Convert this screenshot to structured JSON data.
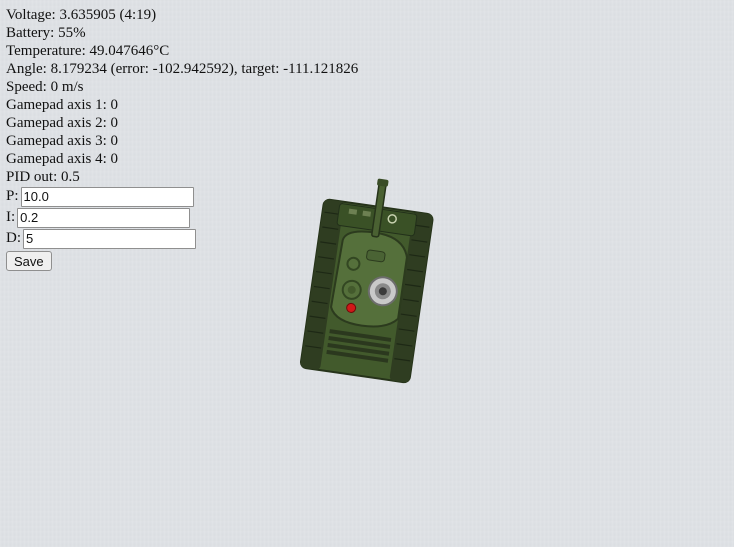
{
  "telemetry": {
    "voltage": "Voltage: 3.635905 (4:19)",
    "battery": "Battery: 55%",
    "temperature": "Temperature: 49.047646°C",
    "angle": "Angle: 8.179234 (error: -102.942592), target: -111.121826",
    "speed": "Speed: 0 m/s",
    "axis1": "Gamepad axis 1: 0",
    "axis2": "Gamepad axis 2: 0",
    "axis3": "Gamepad axis 3: 0",
    "axis4": "Gamepad axis 4: 0",
    "pid_out": "PID out: 0.5"
  },
  "pid_form": {
    "p_label": "P:",
    "p_value": "10.0",
    "i_label": "I:",
    "i_value": "0.2",
    "d_label": "D:",
    "d_value": "5",
    "save_label": "Save"
  },
  "tank": {
    "icon": "tank-image",
    "angle_deg": 8.18,
    "colors": {
      "hull": "#4a6132",
      "turret": "#5b7540",
      "tracks": "#2e3a22",
      "light": "#d01818"
    }
  }
}
